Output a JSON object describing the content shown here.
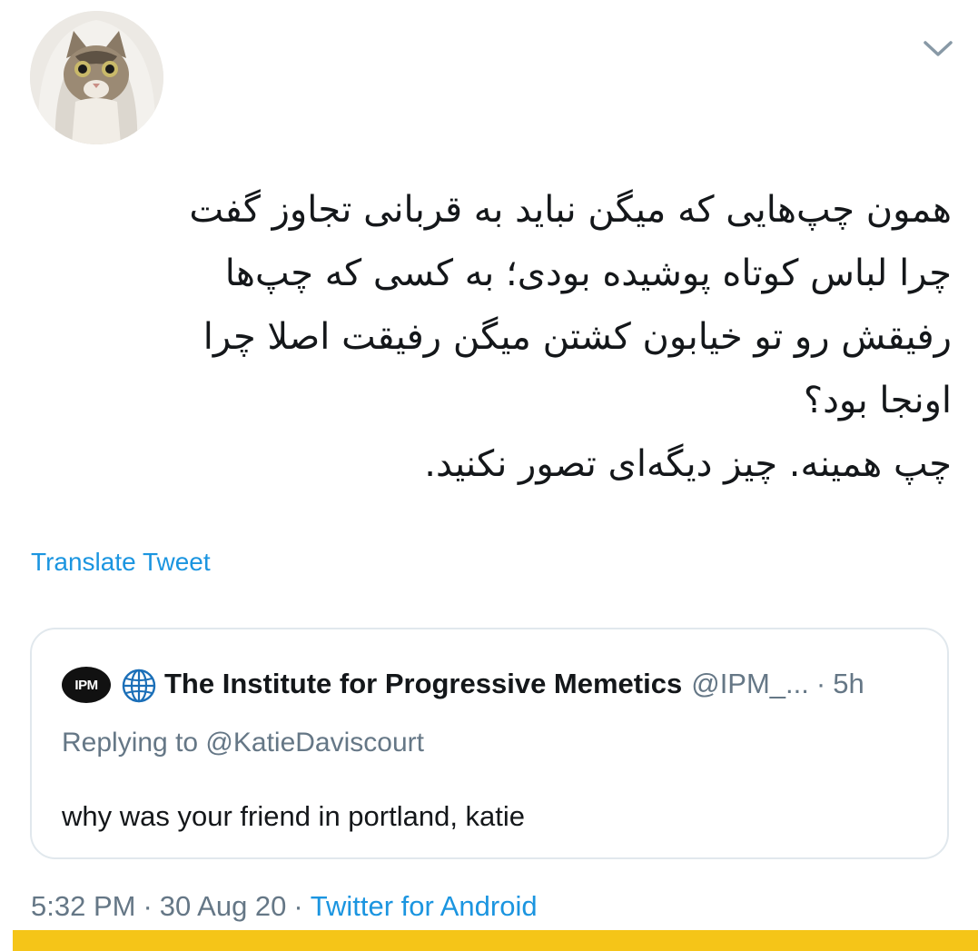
{
  "tweet": {
    "text_lines": [
      "همون چپ‌هایی که میگن نباید به قربانی تجاوز گفت",
      "چرا لباس کوتاه پوشیده بودی؛ به کسی که چپ‌ها",
      "رفیقش رو تو خیابون کشتن میگن رفیقت اصلا چرا",
      "اونجا بود؟",
      "چپ همینه. چیز دیگه‌ای تصور نکنید."
    ],
    "translate_label": "Translate Tweet"
  },
  "quoted_tweet": {
    "logo_text": "IPM",
    "name": "The Institute for Progressive Memetics",
    "handle": "@IPM_...",
    "separator": "·",
    "time": "5h",
    "replying_to": "Replying to @KatieDaviscourt",
    "text": "why was your friend in portland, katie"
  },
  "meta": {
    "time": "5:32 PM",
    "separator": "·",
    "date": "30 Aug 20",
    "source": "Twitter for Android"
  },
  "icons": {
    "avatar": "cat-avatar",
    "chevron": "chevron-down-icon",
    "globe": "globe-icon"
  },
  "colors": {
    "link": "#1b95e0",
    "secondary_text": "#657786",
    "border": "#e1e8ed",
    "highlight_bar": "#f5c518"
  }
}
